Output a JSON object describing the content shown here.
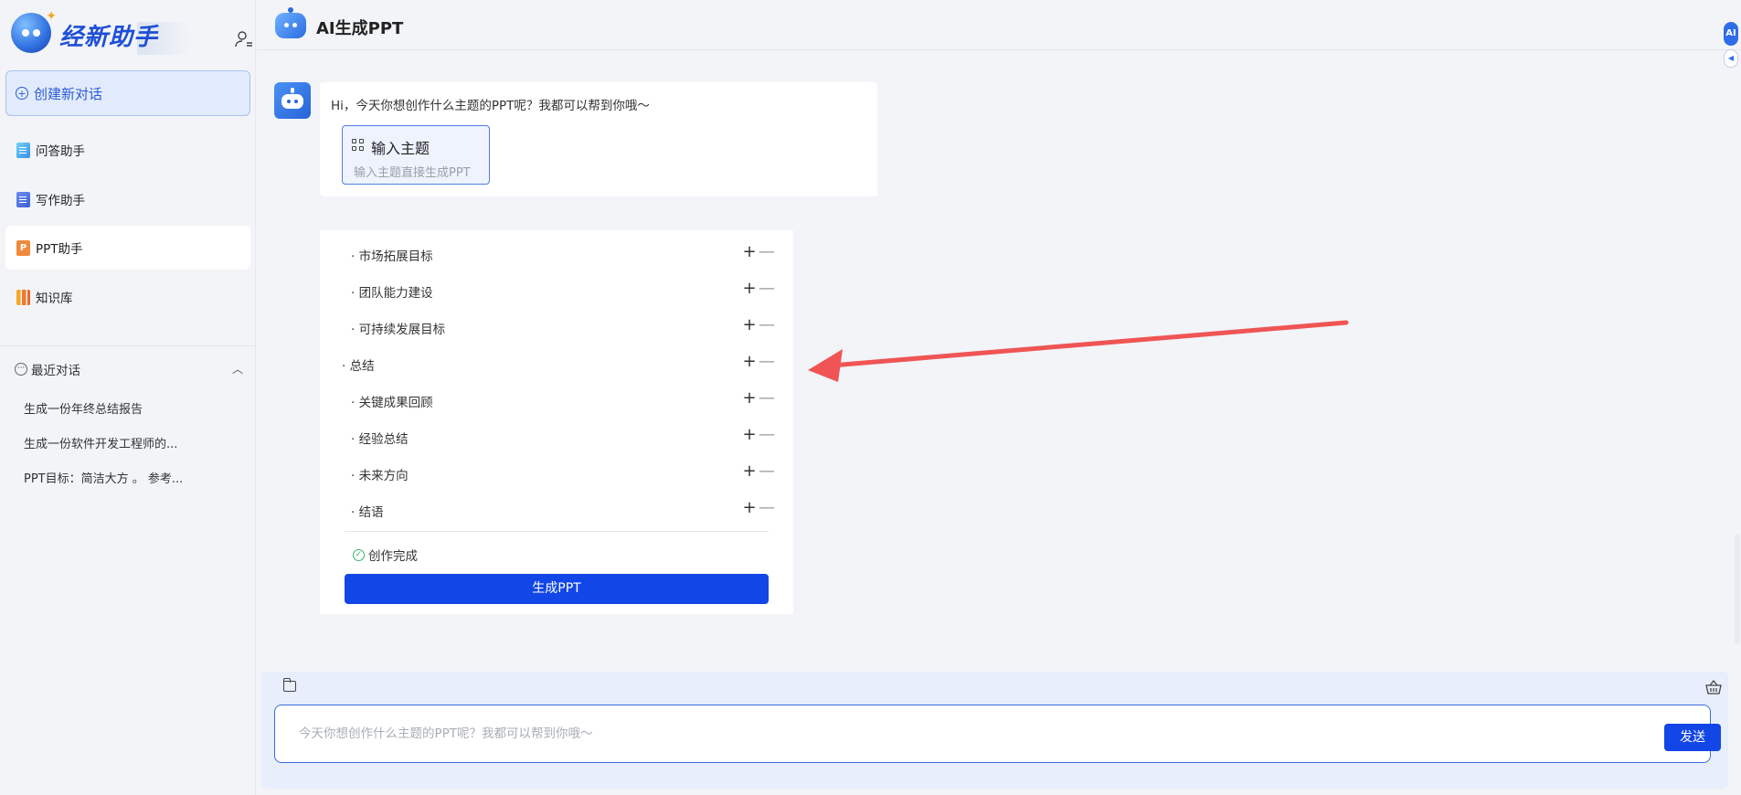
{
  "app": {
    "logo_text": "经新助手",
    "header_title": "AI生成PPT",
    "ai_badge": "AI"
  },
  "sidebar": {
    "new_chat_label": "创建新对话",
    "nav": [
      {
        "label": "问答助手",
        "icon": "document-icon"
      },
      {
        "label": "写作助手",
        "icon": "edit-document-icon"
      },
      {
        "label": "PPT助手",
        "icon": "ppt-icon",
        "active": true
      },
      {
        "label": "知识库",
        "icon": "library-icon"
      }
    ],
    "recent_title": "最近对话",
    "recent": [
      "生成一份年终总结报告",
      "生成一份软件开发工程师的...",
      "PPT目标：简洁大方 。 参考..."
    ]
  },
  "chat": {
    "greeting": "Hi，今天你想创作什么主题的PPT呢？我都可以帮到你哦～",
    "topic_title": "输入主题",
    "topic_sub": "输入主题直接生成PPT",
    "outline": [
      {
        "text": "· 市场拓展目标",
        "level": 2
      },
      {
        "text": "· 团队能力建设",
        "level": 2
      },
      {
        "text": "· 可持续发展目标",
        "level": 2
      },
      {
        "text": "· 总结",
        "level": 1
      },
      {
        "text": "· 关键成果回顾",
        "level": 2
      },
      {
        "text": "· 经验总结",
        "level": 2
      },
      {
        "text": "· 未来方向",
        "level": 2
      },
      {
        "text": "· 结语",
        "level": 2
      }
    ],
    "plus_symbol": "+",
    "minus_symbol": "—",
    "status": "创作完成",
    "generate_label": "生成PPT"
  },
  "composer": {
    "placeholder": "今天你想创作什么主题的PPT呢？我都可以帮到你哦～",
    "value": "",
    "send_label": "发送"
  },
  "colors": {
    "primary": "#1246e6",
    "arrow": "#f05454",
    "sidebar_bg": "#f2f4f7"
  }
}
